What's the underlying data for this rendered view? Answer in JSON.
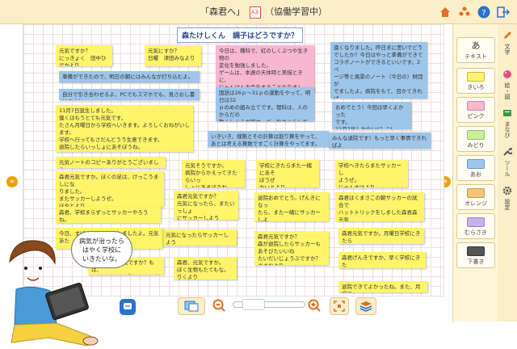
{
  "window": {
    "title_left": "「森君へ」",
    "title_icon": "A3",
    "title_right": "（協働学習中）"
  },
  "toolbar_icons": [
    "home-icon",
    "group-icon",
    "help-icon",
    "logout-icon"
  ],
  "board": {
    "theme": "森たけしくん　調子はどうですか？",
    "notes": [
      {
        "text": "元気ですか？\nにっきょく　田中ひでかより",
        "color": "yellow"
      },
      {
        "text": "元気にすか？\n日曜　津田みなより",
        "color": "yellow"
      },
      {
        "text": "今日は、種科で、虹のしくぶつや生き物の\n変化を勉強しました。\nゲームは、本週の天体時と美描ときに、\nじゃんけん大会をすることなりました。\n日直より",
        "color": "pink"
      },
      {
        "text": "遠くなりました。昨日まに思いでどう\nでしたか？今日はやっと準備ができて\nコラボノートができるといいです。2ペ\nージ等と風景のノート（今日の）財団が\nでましたよ。病院をもて、目かてきれば\n、イロ題をやってみてください。\n森本",
        "color": "blue"
      },
      {
        "text": "準備ができたので、明日の朝にはみんなが打ち込むよ。",
        "color": "blue"
      },
      {
        "text": "自分で引き合わせるよ、PCでもスマホでも、見さおし書けるよ！",
        "color": "blue"
      },
      {
        "text": "国語は26ｐ～31ｐの運動をやって、明日は32\nｐのめの組み立てです。理科は、人のからだの\n動くしくみが終わって、秋のくらしで観察に行\nきます。",
        "color": "blue"
      },
      {
        "text": "11月7日誕生しました。\n僕くはもうとても元気です。\nたさん月曜日から学校へいきます。よろしくおねがいします。\n学校へ行ってもさだんどうう生意できます。\n退院したらいっしょにあそぼうね。\n森たけしより",
        "color": "yellow"
      },
      {
        "text": "おめでとう！今回は早くよかった\nです。\n11月7日しかない(^_^)",
        "color": "blue"
      },
      {
        "text": "いきいき、様態とその計算は割り算をやって、\nあとは考える算数ですごく計算をやってます。",
        "color": "blue"
      },
      {
        "text": "みんな退院です！もっと早く事情できればよ\nかったんだけど、遅くなってごめんね。森本",
        "color": "blue"
      },
      {
        "text": "元気ノートのコピーありがとうございました。",
        "color": "yellow"
      },
      {
        "text": "元気そうですか。\n病院からかえってきたらいっ\nしょにあそぼうね。",
        "color": "yellow"
      },
      {
        "text": "学校にきたらまた一緒にあそ\nぼうぜ\nかいとより",
        "color": "yellow"
      },
      {
        "text": "学校へきたらまたサッカーし\nようぜ。\nじゅんすけより",
        "color": "yellow"
      },
      {
        "text": "森君元気ですか。ぼくの足は、けっこうましにな\nりました。\nまたサッカーしようぜ。\nほやとより",
        "color": "yellow"
      },
      {
        "text": "森君元気ですか？\n元気になったら、またいっしょ\nにサッカーしよう\nまさとより",
        "color": "yellow"
      },
      {
        "text": "退院おめでとう。げんきになっ\nたら、また一緒にサッカーしよ\nうね。\nたいちより",
        "color": "yellow"
      },
      {
        "text": "森君はくまさこの朝サッカーの試合で\nハットトリックをしました森君森元気\nになってまた試合できるのを\nひきまより",
        "color": "yellow"
      },
      {
        "text": "森君、学校まらずっとサッカーやろうね。\nたくみより",
        "color": "yellow"
      },
      {
        "text": "元気になったらサッカーしよう\nね。　ゆうたろうより",
        "color": "yellow"
      },
      {
        "text": "森君元気ですか？\n森が退院したらサッカーもあそびたいいね\nたいだいじょうぶですか？\nささおより",
        "color": "yellow"
      },
      {
        "text": "森君元気ですか。月曜日学校にきたら\nさ",
        "color": "yellow"
      },
      {
        "text": "今日、すばるしょうたいしましたよ。元気\nあた",
        "color": "yellow"
      },
      {
        "text": "森君、元気ですか。\nぼく生物もたてもな。\nりくより",
        "color": "yellow"
      },
      {
        "text": "森君げんきですか、早く学校にきた\nて、みんなと遊ぼうね。　りおより",
        "color": "yellow"
      },
      {
        "text": "なかなか、元気ですか？もは、\nになれから、退院したら、学校へ",
        "color": "yellow"
      },
      {
        "text": "退院できてよかったね。また、月曜日",
        "color": "yellow"
      }
    ]
  },
  "bubble": {
    "text": "病気が治ったら\nはやく学校に\nいきたいな。"
  },
  "palette": {
    "items": [
      {
        "label": "テキスト",
        "color": "#ffffff",
        "icon": "あ"
      },
      {
        "label": "きいろ",
        "color": "#fff46a"
      },
      {
        "label": "ピンク",
        "color": "#f7b7cf"
      },
      {
        "label": "みどり",
        "color": "#c9ef9a"
      },
      {
        "label": "あお",
        "color": "#9ec6ea"
      },
      {
        "label": "オレンジ",
        "color": "#f7c27a"
      },
      {
        "label": "むらさき",
        "color": "#c6b2e6"
      },
      {
        "label": "下書き",
        "color": "#555555"
      }
    ]
  },
  "tabs": [
    {
      "label": "文字",
      "icon": "pencil-icon"
    },
    {
      "label": "絵・図",
      "icon": "palette-icon"
    },
    {
      "label": "まなび",
      "icon": "learn-icon"
    },
    {
      "label": "ツール",
      "icon": "wrench-icon"
    },
    {
      "label": "設定",
      "icon": "gear-icon"
    }
  ],
  "bottom_icons": [
    "chat-icon",
    "image-insert-icon",
    "zoom-out-icon",
    "zoom-in-icon",
    "fit-icon",
    "layers-icon"
  ],
  "colors": {
    "accent": "#f0a000",
    "titlebar": "#fbefc9",
    "palette_bg": "#fff6d8"
  }
}
